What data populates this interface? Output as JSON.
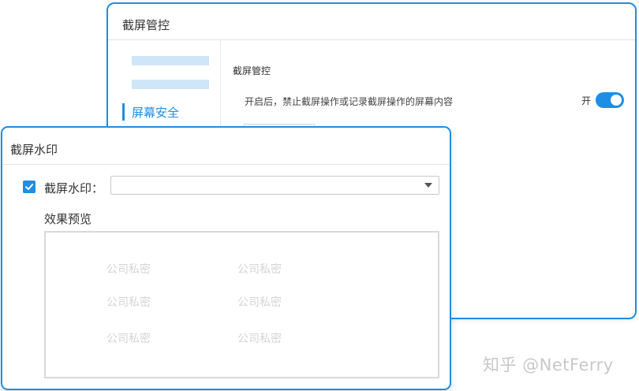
{
  "back_window": {
    "title": "截屏管控",
    "nav": {
      "active_label": "屏幕安全"
    },
    "section_title": "截屏管控",
    "description": "开启后，禁止截屏操作或记录截屏操作的屏幕内容",
    "switch": {
      "label": "开",
      "on": true
    }
  },
  "front_window": {
    "title": "截屏水印",
    "checkbox": {
      "checked": true,
      "label": "截屏水印："
    },
    "select": {
      "value": ""
    },
    "preview_label": "效果预览",
    "watermark_text": "公司私密"
  },
  "credit": "知乎 @NetFerry",
  "colors": {
    "accent": "#1d8ee6",
    "placeholder_bar": "#cfe6f8",
    "watermark": "#d4d4d4"
  }
}
